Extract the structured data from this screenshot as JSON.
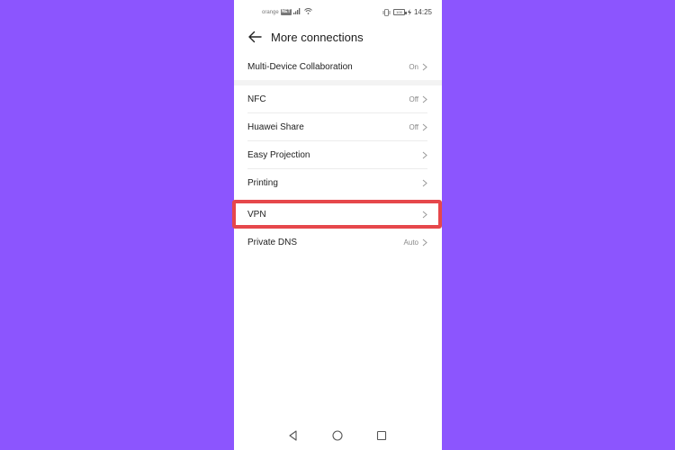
{
  "status_bar": {
    "carrier": "orange",
    "network": "NET",
    "battery": "100",
    "time": "14:25"
  },
  "header": {
    "title": "More connections",
    "back_icon": "arrow-left-icon"
  },
  "settings": {
    "multi_device": {
      "label": "Multi-Device Collaboration",
      "value": "On"
    },
    "nfc": {
      "label": "NFC",
      "value": "Off"
    },
    "huawei_share": {
      "label": "Huawei Share",
      "value": "Off"
    },
    "easy_projection": {
      "label": "Easy Projection",
      "value": ""
    },
    "printing": {
      "label": "Printing",
      "value": ""
    },
    "vpn": {
      "label": "VPN",
      "value": ""
    },
    "private_dns": {
      "label": "Private DNS",
      "value": "Auto"
    }
  },
  "colors": {
    "background": "#8c55fe",
    "highlight": "#e6474b",
    "screen": "#ffffff"
  }
}
